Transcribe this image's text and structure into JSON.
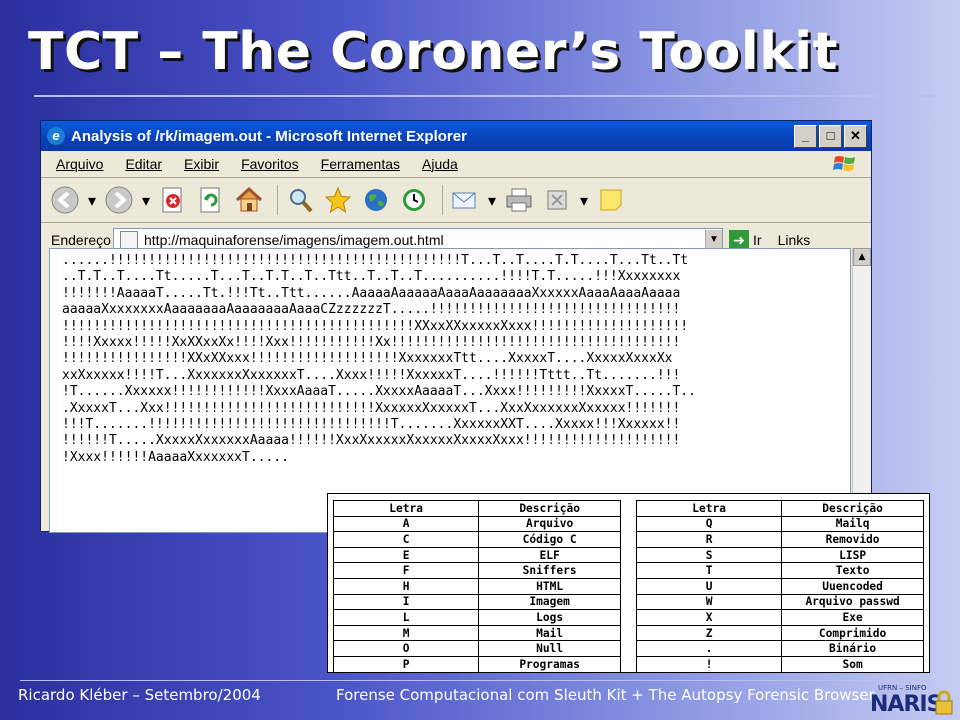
{
  "slide": {
    "title": "TCT – The Coroner’s Toolkit",
    "footer_left": "Ricardo Kléber – Setembro/2004",
    "footer_right": "Forense Computacional com Sleuth Kit + The Autopsy Forensic Browser",
    "logo_small": "UFRN – SINFO",
    "logo_big": "NARIS"
  },
  "browser": {
    "title": "Analysis of /rk/imagem.out - Microsoft Internet Explorer",
    "menu": [
      "Arquivo",
      "Editar",
      "Exibir",
      "Favoritos",
      "Ferramentas",
      "Ajuda"
    ],
    "address_label": "Endereço",
    "address_value": "http://maquinaforense/imagens/imagem.out.html",
    "go_label": "Ir",
    "links_label": "Links"
  },
  "content_lines": [
    "......!!!!!!!!!!!!!!!!!!!!!!!!!!!!!!!!!!!!!!!!!!!!!T...T..T....T.T....T...Tt..Tt",
    "..T.T..T....Tt.....T...T..T.T..T..Ttt..T..T..T..........!!!!T.T.....!!!Xxxxxxxx",
    "!!!!!!!AaaaaT.....Tt.!!!Tt..Ttt......AaaaaAaaaaaAaaaAaaaaaaaXxxxxxAaaaAaaaAaaaa",
    "aaaaaXxxxxxxxAaaaaaaaAaaaaaaaAaaaCZzzzzzzT.....!!!!!!!!!!!!!!!!!!!!!!!!!!!!!!!!",
    "!!!!!!!!!!!!!!!!!!!!!!!!!!!!!!!!!!!!!!!!!!!!!XXxxXXxxxxxXxxx!!!!!!!!!!!!!!!!!!!!",
    "!!!!Xxxxx!!!!!XxXXxxXx!!!!Xxx!!!!!!!!!!!Xx!!!!!!!!!!!!!!!!!!!!!!!!!!!!!!!!!!!!!",
    "!!!!!!!!!!!!!!!!XXxXXxxx!!!!!!!!!!!!!!!!!!!XxxxxxxTtt....XxxxxT....XxxxxXxxxXx",
    "xxXxxxxx!!!!T...XxxxxxxXxxxxxxT....Xxxx!!!!!XxxxxxT....!!!!!!Tttt..Tt.......!!!",
    "!T......Xxxxxx!!!!!!!!!!!!XxxxAaaaT.....XxxxxAaaaaT...Xxxx!!!!!!!!!XxxxxT.....T..",
    ".XxxxxT...Xxx!!!!!!!!!!!!!!!!!!!!!!!!!!!XxxxxxXxxxxxT...XxxXxxxxxxXxxxxx!!!!!!!",
    "!!!T.......!!!!!!!!!!!!!!!!!!!!!!!!!!!!!!!T.......XxxxxxXXT....Xxxxx!!!Xxxxxx!!",
    "!!!!!!T.....XxxxxXxxxxxxAaaaa!!!!!!XxxXxxxxxXxxxxxXxxxxXxxx!!!!!!!!!!!!!!!!!!!!",
    "!Xxxx!!!!!!AaaaaXxxxxxxT....."
  ],
  "legend": {
    "headers": [
      "Letra",
      "Descrição",
      "Letra",
      "Descrição"
    ],
    "left": [
      [
        "A",
        "Arquivo"
      ],
      [
        "C",
        "Código C"
      ],
      [
        "E",
        "ELF"
      ],
      [
        "F",
        "Sniffers"
      ],
      [
        "H",
        "HTML"
      ],
      [
        "I",
        "Imagem"
      ],
      [
        "L",
        "Logs"
      ],
      [
        "M",
        "Mail"
      ],
      [
        "O",
        "Null"
      ],
      [
        "P",
        "Programas"
      ]
    ],
    "right": [
      [
        "Q",
        "Mailq"
      ],
      [
        "R",
        "Removido"
      ],
      [
        "S",
        "LISP"
      ],
      [
        "T",
        "Texto"
      ],
      [
        "U",
        "Uuencoded"
      ],
      [
        "W",
        "Arquivo passwd"
      ],
      [
        "X",
        "Exe"
      ],
      [
        "Z",
        "Comprimido"
      ],
      [
        ".",
        "Binário"
      ],
      [
        "!",
        "Som"
      ]
    ]
  }
}
